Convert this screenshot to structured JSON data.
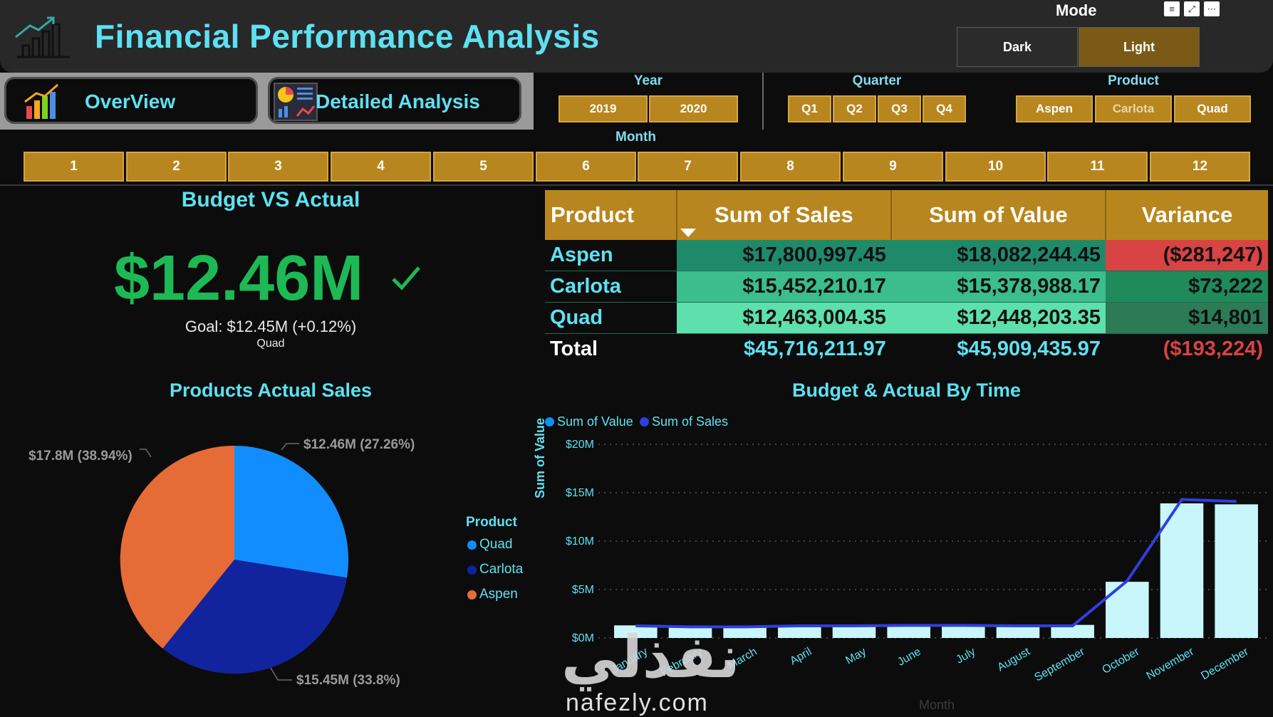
{
  "header": {
    "title": "Financial Performance Analysis",
    "mode_label": "Mode",
    "mode_options": [
      "Dark",
      "Light"
    ],
    "mode_selected": "Light",
    "header_icons": [
      "filter-icon",
      "focus-mode-icon",
      "more-options-icon"
    ],
    "logo_icon": "bar-chart-trend-icon"
  },
  "nav": {
    "overview_label": "OverView",
    "detailed_label": "Detailed Analysis"
  },
  "slicers": {
    "year_title": "Year",
    "years": [
      "2019",
      "2020"
    ],
    "quarter_title": "Quarter",
    "quarters": [
      "Q1",
      "Q2",
      "Q3",
      "Q4"
    ],
    "product_title": "Product",
    "products": [
      "Aspen",
      "Carlota",
      "Quad"
    ],
    "month_title": "Month",
    "months": [
      "1",
      "2",
      "3",
      "4",
      "5",
      "6",
      "7",
      "8",
      "9",
      "10",
      "11",
      "12"
    ]
  },
  "kpi": {
    "title": "Budget VS Actual",
    "value": "$12.46M",
    "goal": "Goal: $12.45M (+0.12%)",
    "subtitle": "Quad",
    "value_color": "#1db954"
  },
  "table": {
    "headers": [
      "Product",
      "Sum of Sales",
      "Sum of Value",
      "Variance"
    ],
    "rows": [
      {
        "product": "Aspen",
        "sales": "$17,800,997.45",
        "value": "$18,082,244.45",
        "variance": "($281,247)"
      },
      {
        "product": "Carlota",
        "sales": "$15,452,210.17",
        "value": "$15,378,988.17",
        "variance": "$73,222"
      },
      {
        "product": "Quad",
        "sales": "$12,463,004.35",
        "value": "$12,448,203.35",
        "variance": "$14,801"
      }
    ],
    "total": {
      "label": "Total",
      "sales": "$45,716,211.97",
      "value": "$45,909,435.97",
      "variance": "($193,224)"
    },
    "colors": {
      "header": "#b8861e",
      "aspen_fill": "#1f8a6a",
      "carlota_fill": "#3bbd8e",
      "quad_fill": "#5de0ac",
      "negative": "#d84343",
      "positive_variance_dark": "#1f6a4a"
    }
  },
  "pie": {
    "title": "Products Actual Sales",
    "legend_title": "Product",
    "legend": [
      {
        "name": "Quad",
        "color": "#118dff"
      },
      {
        "name": "Carlota",
        "color": "#12239e"
      },
      {
        "name": "Aspen",
        "color": "#e66c37"
      }
    ],
    "labels": {
      "quad": "$12.46M (27.26%)",
      "carlota": "$15.45M (33.8%)",
      "aspen": "$17.8M (38.94%)"
    }
  },
  "combo": {
    "title": "Budget & Actual By Time",
    "legend": [
      {
        "name": "Sum of Value",
        "color": "#118dff"
      },
      {
        "name": "Sum of Sales",
        "color": "#2f3fe0"
      }
    ],
    "y_title": "Sum of Value",
    "x_title": "Month",
    "y_ticks": [
      "$20M",
      "$15M",
      "$10M",
      "$5M",
      "$0M"
    ]
  },
  "chart_data": {
    "type": "bar",
    "title": "Budget & Actual By Time",
    "xlabel": "Month",
    "ylabel": "Sum of Value",
    "ylim": [
      0,
      20000000
    ],
    "categories": [
      "January",
      "February",
      "March",
      "April",
      "May",
      "June",
      "July",
      "August",
      "September",
      "October",
      "November",
      "December"
    ],
    "series": [
      {
        "name": "Sum of Value",
        "kind": "bar",
        "color": "#c9f6fb",
        "values": [
          1300000,
          1100000,
          1150000,
          1200000,
          1200000,
          1400000,
          1300000,
          1200000,
          1350000,
          5800000,
          13900000,
          13800000
        ]
      },
      {
        "name": "Sum of Sales",
        "kind": "line",
        "color": "#2f3fe0",
        "values": [
          1250000,
          1150000,
          1150000,
          1250000,
          1250000,
          1300000,
          1300000,
          1250000,
          1250000,
          5900000,
          14300000,
          14100000
        ]
      }
    ],
    "grid": true,
    "legend": "top-left"
  },
  "watermark": {
    "arabic": "نفذلي",
    "latin": "nafezly.com"
  }
}
